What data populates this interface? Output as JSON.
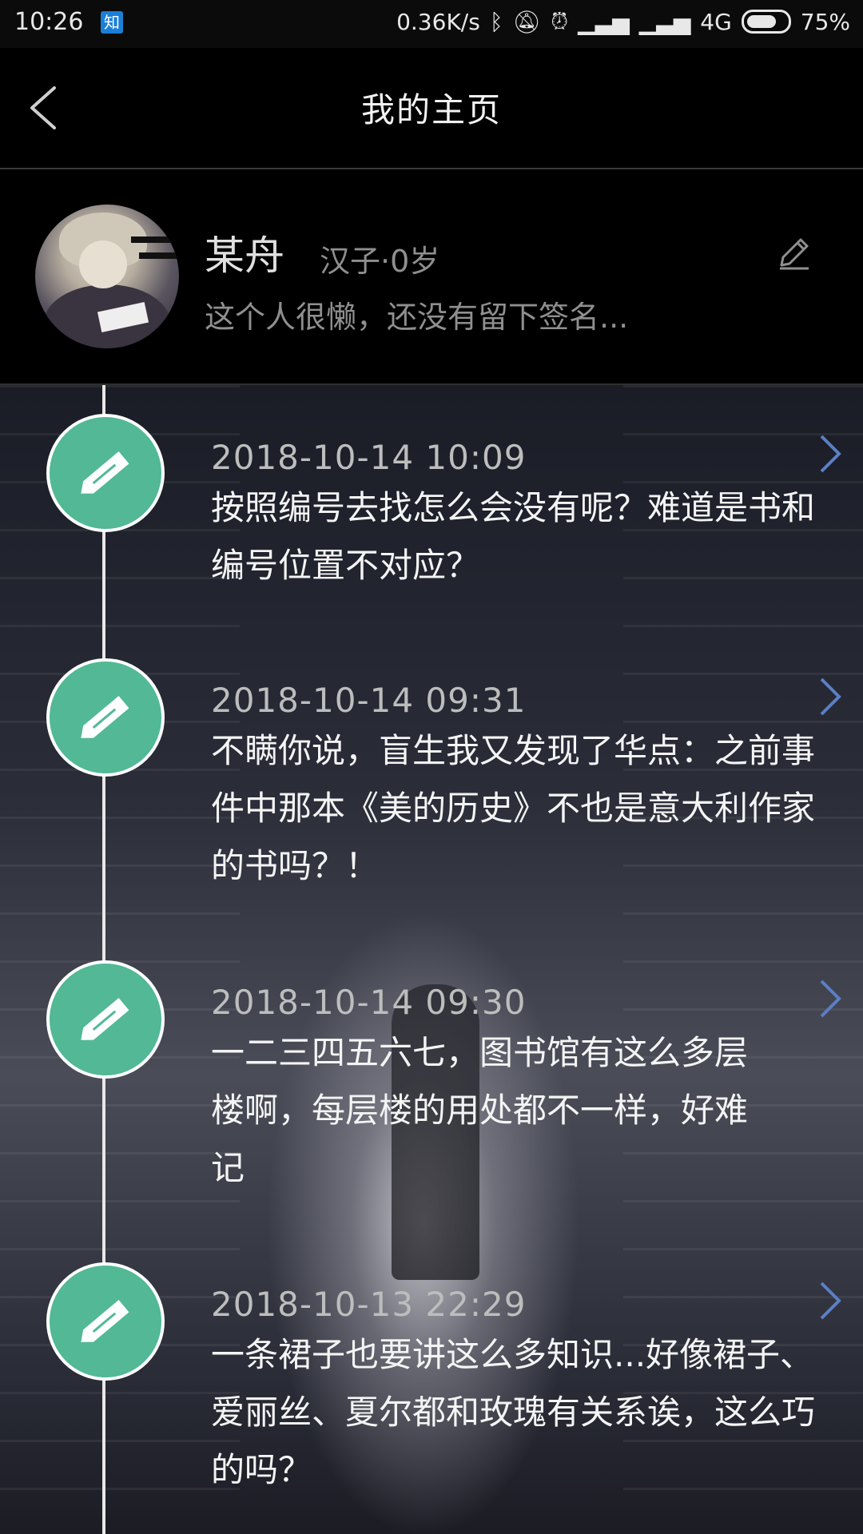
{
  "status_bar": {
    "time": "10:26",
    "app_badge": "知",
    "network_speed": "0.36K/s",
    "network_type": "4G",
    "battery": "75%"
  },
  "header": {
    "title": "我的主页"
  },
  "profile": {
    "name": "某舟",
    "meta": "汉子·0岁",
    "bio": "这个人很懒，还没有留下签名..."
  },
  "entries": [
    {
      "date": "2018-10-14 10:09",
      "text": "按照编号去找怎么会没有呢？难道是书和编号位置不对应？"
    },
    {
      "date": "2018-10-14 09:31",
      "text": "不瞒你说，盲生我又发现了华点：之前事件中那本《美的历史》不也是意大利作家的书吗？！"
    },
    {
      "date": "2018-10-14 09:30",
      "text": "一二三四五六七，图书馆有这么多层楼啊，每层楼的用处都不一样，好难记"
    },
    {
      "date": "2018-10-13 22:29",
      "text": "一条裙子也要讲这么多知识...好像裙子、爱丽丝、夏尔都和玫瑰有关系诶，这么巧的吗？"
    }
  ],
  "colors": {
    "node": "#52b895",
    "chevron": "#5b7fc4"
  }
}
